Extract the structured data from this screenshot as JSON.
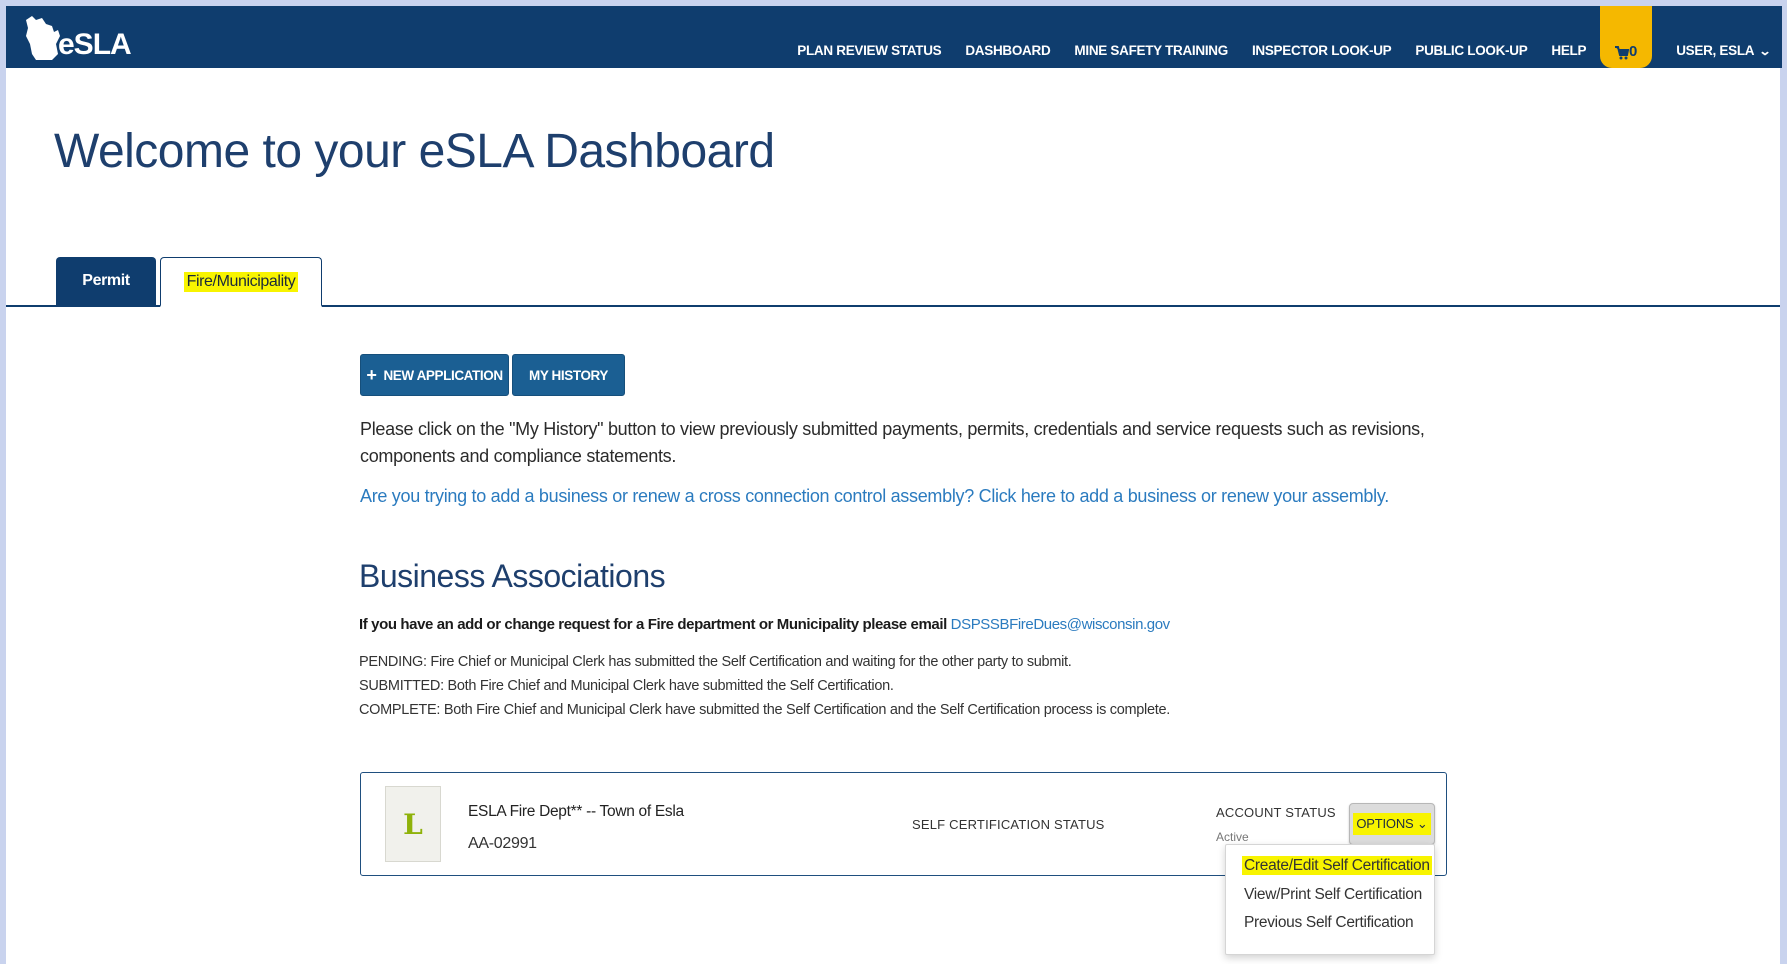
{
  "header": {
    "logo_text": "eSLA",
    "nav": [
      {
        "label": "PLAN REVIEW STATUS"
      },
      {
        "label": "DASHBOARD"
      },
      {
        "label": "MINE SAFETY TRAINING"
      },
      {
        "label": "INSPECTOR LOOK-UP"
      },
      {
        "label": "PUBLIC LOOK-UP"
      },
      {
        "label": "HELP"
      }
    ],
    "cart_count": "0",
    "user_label": "USER, ESLA"
  },
  "page": {
    "title": "Welcome to your eSLA Dashboard"
  },
  "tabs": [
    {
      "label": "Permit"
    },
    {
      "label": "Fire/Municipality"
    }
  ],
  "actions": {
    "new_application": "NEW APPLICATION",
    "my_history": "MY HISTORY"
  },
  "content": {
    "history_text": "Please click on the \"My History\" button to view previously submitted payments, permits, credentials and service requests such as revisions, components and compliance statements.",
    "business_link": "Are you trying to add a business or renew a cross connection control assembly? Click here to add a business or renew your assembly."
  },
  "business": {
    "title": "Business Associations",
    "email_prompt": "If you have an add or change request for a Fire department or Municipality please email",
    "email": "DSPSSBFireDues@wisconsin.gov",
    "status_notes": [
      "PENDING: Fire Chief or Municipal Clerk has submitted the Self Certification and waiting for the other party to submit.",
      "SUBMITTED: Both Fire Chief and Municipal Clerk have submitted the Self Certification.",
      "COMPLETE: Both Fire Chief and Municipal Clerk have submitted the Self Certification and the Self Certification process is complete."
    ]
  },
  "card": {
    "badge_letter": "L",
    "org_name": "ESLA Fire Dept** -- Town of Esla",
    "org_id": "AA-02991",
    "self_cert_label": "SELF CERTIFICATION STATUS",
    "account_status_label": "ACCOUNT STATUS",
    "account_status_value": "Active",
    "options_label": "OPTIONS"
  },
  "dropdown": {
    "items": [
      {
        "label": "Create/Edit Self Certification"
      },
      {
        "label": "View/Print Self Certification"
      },
      {
        "label": "Previous Self Certification"
      }
    ]
  },
  "colors": {
    "brand_navy": "#0f3d6e",
    "button_blue": "#1b5f93",
    "link_blue": "#2b7bbf",
    "cart_yellow": "#f5b800",
    "highlight_yellow": "#f8f400"
  },
  "icons": [
    "wisconsin-map-logo-icon",
    "plus-icon",
    "cart-icon",
    "chevron-down-icon"
  ]
}
